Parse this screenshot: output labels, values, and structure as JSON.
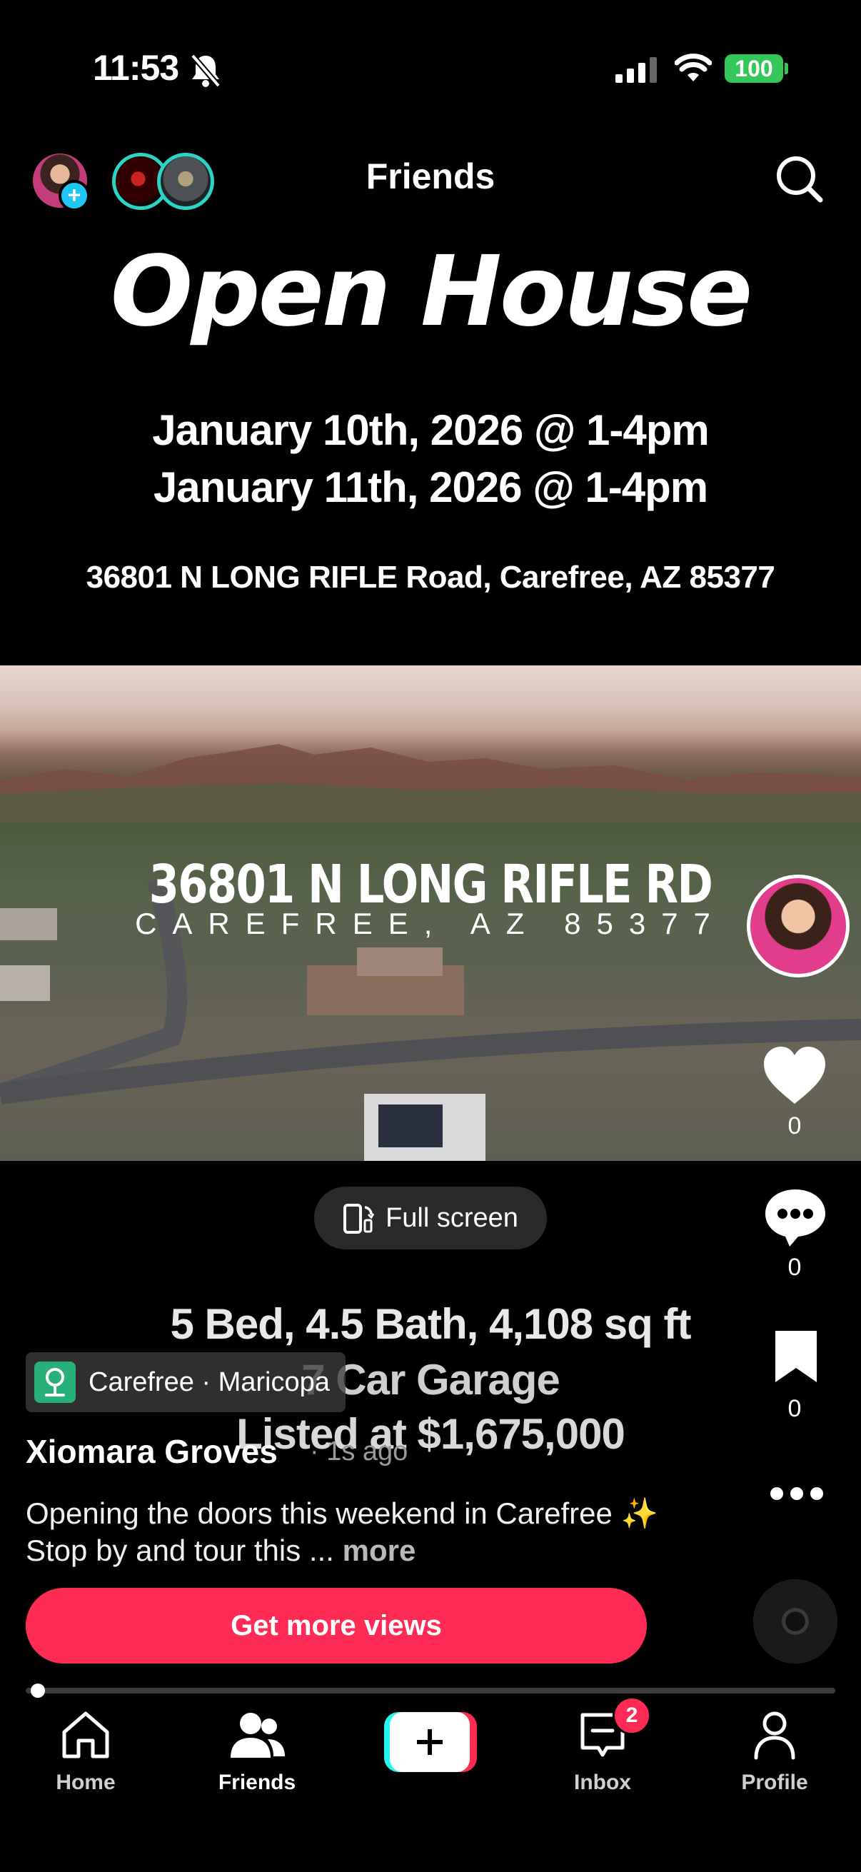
{
  "status_bar": {
    "time": "11:53",
    "battery": "100"
  },
  "nav": {
    "title": "Friends"
  },
  "header": {
    "title": "Open House",
    "dates": [
      "January 10th, 2026 @ 1-4pm",
      "January 11th, 2026 @ 1-4pm"
    ],
    "address": "36801 N LONG RIFLE Road, Carefree, AZ 85377"
  },
  "photo_overlay": {
    "address": "36801 N LONG RIFLE RD",
    "city": "CAREFREE, AZ 85377"
  },
  "rail": {
    "likes": "0",
    "comments": "0",
    "saves": "0"
  },
  "fullscreen": {
    "label": "Full screen"
  },
  "specs": [
    "5 Bed, 4.5 Bath, 4,108 sq ft",
    "7 Car Garage",
    "Listed at $1,675,000"
  ],
  "location": {
    "label": "Carefree · Maricopa"
  },
  "post": {
    "creator": "Xiomara Groves",
    "time": "· 1s ago",
    "caption": "Opening the doors this weekend in Carefree ✨ Stop by and tour this ...",
    "more": "more"
  },
  "cta": {
    "label": "Get more views"
  },
  "video": {
    "progress": 0.01
  },
  "tabs": [
    {
      "label": "Home"
    },
    {
      "label": "Friends"
    },
    {
      "label": "Inbox",
      "badge": "2"
    },
    {
      "label": "Profile"
    }
  ],
  "colors": {
    "accent": "#fe2c55",
    "teal": "#20c6f4",
    "battery": "#34c759"
  }
}
